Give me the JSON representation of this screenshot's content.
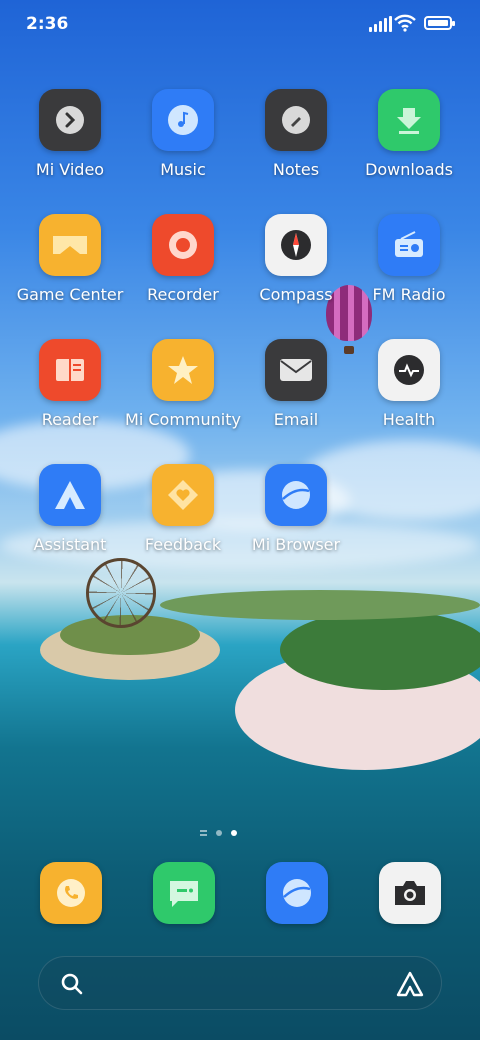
{
  "status_bar": {
    "time": "2:36"
  },
  "apps": [
    {
      "label": "Mi Video",
      "icon": "mi-video-icon",
      "color": "#3a3a3c"
    },
    {
      "label": "Music",
      "icon": "music-icon",
      "color": "#2f7cf6"
    },
    {
      "label": "Notes",
      "icon": "notes-icon",
      "color": "#3a3a3c"
    },
    {
      "label": "Downloads",
      "icon": "downloads-icon",
      "color": "#2fc96b"
    },
    {
      "label": "Game Center",
      "icon": "game-center-icon",
      "color": "#f7b22f"
    },
    {
      "label": "Recorder",
      "icon": "recorder-icon",
      "color": "#ee4a2c"
    },
    {
      "label": "Compass",
      "icon": "compass-icon",
      "color": "#f2f2f2"
    },
    {
      "label": "FM Radio",
      "icon": "fm-radio-icon",
      "color": "#2f7cf6"
    },
    {
      "label": "Reader",
      "icon": "reader-icon",
      "color": "#ee4a2c"
    },
    {
      "label": "Mi Community",
      "icon": "mi-community-icon",
      "color": "#f7b22f"
    },
    {
      "label": "Email",
      "icon": "email-icon",
      "color": "#3a3a3c"
    },
    {
      "label": "Health",
      "icon": "health-icon",
      "color": "#f2f2f2"
    },
    {
      "label": "Assistant",
      "icon": "assistant-icon",
      "color": "#2f7cf6"
    },
    {
      "label": "Feedback",
      "icon": "feedback-icon",
      "color": "#f7b22f"
    },
    {
      "label": "Mi Browser",
      "icon": "browser-icon",
      "color": "#2f7cf6"
    }
  ],
  "page_indicator": {
    "pages": 2,
    "current": 2
  },
  "dock": [
    {
      "icon": "phone-icon",
      "color": "#f7b22f"
    },
    {
      "icon": "messaging-icon",
      "color": "#2fc96b"
    },
    {
      "icon": "browser-icon",
      "color": "#2f7cf6"
    },
    {
      "icon": "camera-icon",
      "color": "#f2f2f2"
    }
  ],
  "search_bar": {
    "left_icon": "search-icon",
    "right_icon": "assistant-icon"
  }
}
